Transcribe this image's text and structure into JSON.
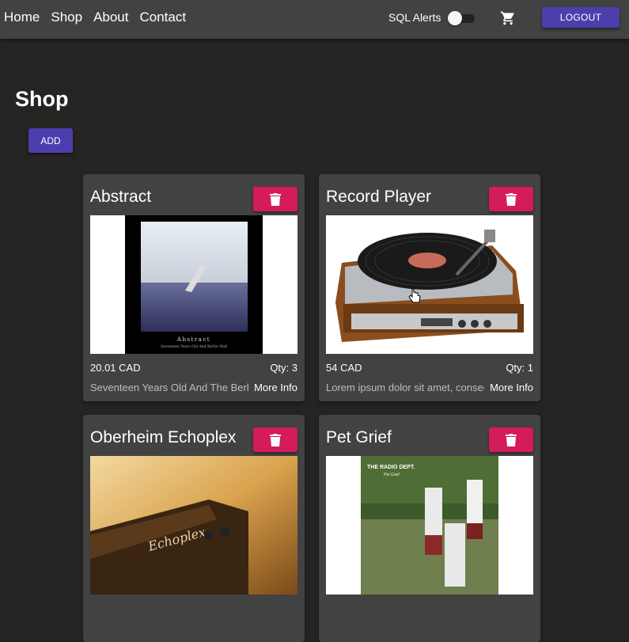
{
  "nav": {
    "links": [
      "Home",
      "Shop",
      "About",
      "Contact"
    ],
    "sql_alerts_label": "SQL Alerts",
    "sql_alerts_on": false,
    "logout_label": "LOGOUT"
  },
  "page": {
    "title": "Shop",
    "add_label": "ADD"
  },
  "products": [
    {
      "title": "Abstract",
      "price": "20.01 CAD",
      "qty": "Qty: 3",
      "description": "Seventeen Years Old And The Berlin Wall",
      "more_info": "More Info",
      "image": {
        "caption_title": "Abstract",
        "caption_sub": "Seventeen Years Old And Berlin Wall"
      }
    },
    {
      "title": "Record Player",
      "price": "54 CAD",
      "qty": "Qty: 1",
      "description": "Lorem ipsum dolor sit amet, consectetur",
      "more_info": "More Info"
    },
    {
      "title": "Oberheim Echoplex",
      "price": "",
      "qty": "",
      "description": "",
      "more_info": "",
      "image": {
        "label": "Echoplex"
      }
    },
    {
      "title": "Pet Grief",
      "price": "",
      "qty": "",
      "description": "",
      "more_info": "",
      "image": {
        "band": "THE RADIO DEPT.",
        "album": "Pet Grief"
      }
    }
  ],
  "colors": {
    "primary": "#4c3fad",
    "danger": "#d41b5c",
    "card": "#424242",
    "background": "#252422"
  }
}
